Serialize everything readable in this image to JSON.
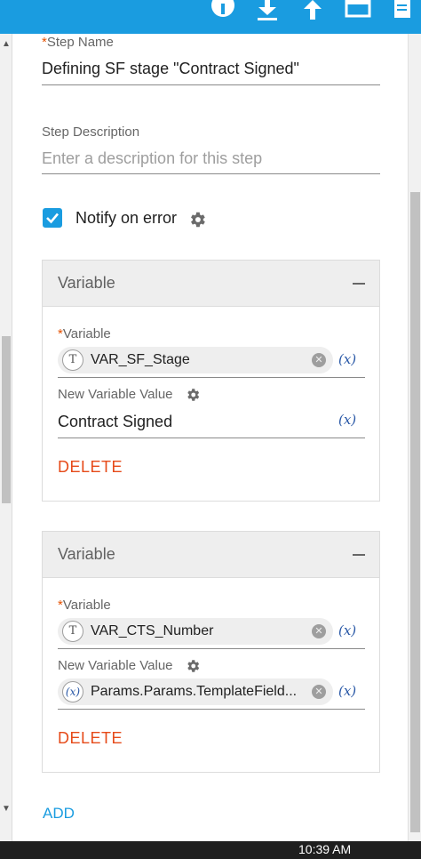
{
  "toolbar": {
    "icons": [
      "info-icon",
      "download-icon",
      "upload-icon",
      "window-icon",
      "document-icon"
    ]
  },
  "form": {
    "step_name_label": "Step Name",
    "required_mark": "*",
    "step_name_value": "Defining SF stage \"Contract Signed\"",
    "step_description_label": "Step Description",
    "step_description_placeholder": "Enter a description for this step",
    "notify_label": "Notify on error",
    "notify_checked": true
  },
  "variables": [
    {
      "header": "Variable",
      "variable_label": "Variable",
      "variable_type": "T",
      "variable_name": "VAR_SF_Stage",
      "value_label": "New Variable Value",
      "value_text": "Contract Signed",
      "value_is_chip": false,
      "fx_label": "(x)",
      "delete_label": "DELETE"
    },
    {
      "header": "Variable",
      "variable_label": "Variable",
      "variable_type": "T",
      "variable_name": "VAR_CTS_Number",
      "value_label": "New Variable Value",
      "value_chip_type": "x",
      "value_text": "Params.Params.TemplateField...",
      "value_is_chip": true,
      "fx_label": "(x)",
      "delete_label": "DELETE"
    }
  ],
  "add_label": "ADD",
  "taskbar": {
    "clock": "10:39 AM"
  },
  "colors": {
    "accent": "#1a9ce0",
    "danger": "#e64a19",
    "expression": "#2857a6"
  }
}
